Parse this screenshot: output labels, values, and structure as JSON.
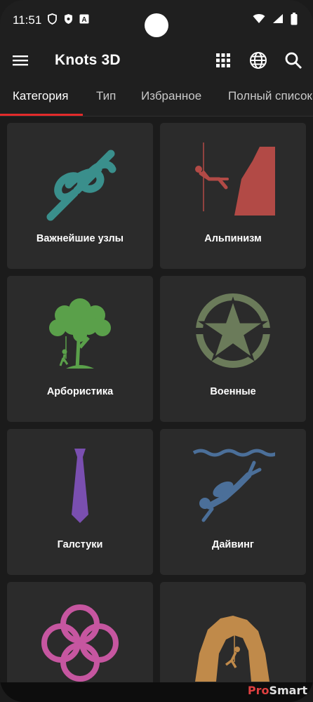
{
  "status_bar": {
    "time": "11:51",
    "left_icons": [
      "shield-outline-icon",
      "shield-filled-icon",
      "font-a-icon"
    ],
    "right_icons": [
      "wifi-icon",
      "signal-icon",
      "battery-icon"
    ]
  },
  "app_bar": {
    "title": "Knots 3D",
    "actions": [
      "grid-icon",
      "globe-icon",
      "search-icon"
    ]
  },
  "tabs": [
    {
      "label": "Категория",
      "active": true
    },
    {
      "label": "Тип",
      "active": false
    },
    {
      "label": "Избранное",
      "active": false
    },
    {
      "label": "Полный список",
      "active": false
    }
  ],
  "categories": [
    {
      "label": "Важнейшие узлы",
      "icon": "knot-icon",
      "color": "#3a8f8c"
    },
    {
      "label": "Альпинизм",
      "icon": "climbing-icon",
      "color": "#b24a46"
    },
    {
      "label": "Арбористика",
      "icon": "tree-icon",
      "color": "#5aa04a"
    },
    {
      "label": "Военные",
      "icon": "military-star-icon",
      "color": "#6b7b5a"
    },
    {
      "label": "Галстуки",
      "icon": "necktie-icon",
      "color": "#7a4fb0"
    },
    {
      "label": "Дайвинг",
      "icon": "diver-icon",
      "color": "#4b6f99"
    },
    {
      "label": "",
      "icon": "decorative-knot-icon",
      "color": "#c656a0"
    },
    {
      "label": "",
      "icon": "caving-icon",
      "color": "#c08a4a"
    }
  ],
  "watermark": {
    "prefix": "Pro",
    "suffix": "Smart"
  }
}
